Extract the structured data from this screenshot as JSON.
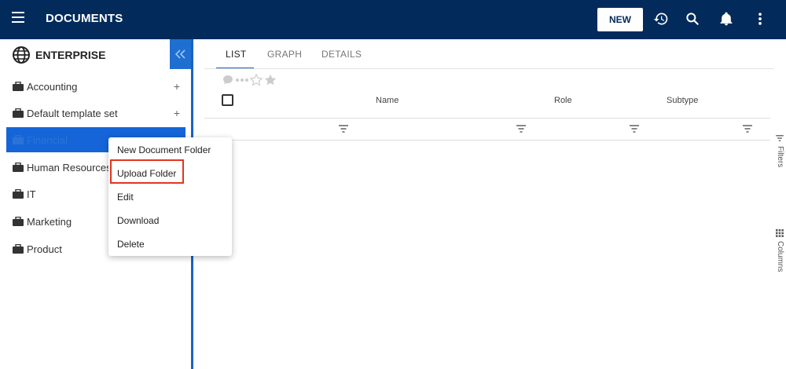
{
  "header": {
    "title": "DOCUMENTS",
    "new_label": "NEW",
    "icons": [
      "menu-icon",
      "history-icon",
      "search-icon",
      "bell-icon",
      "more-vert-icon"
    ]
  },
  "sidebar": {
    "title": "ENTERPRISE",
    "items": [
      {
        "label": "Accounting",
        "expandable": true
      },
      {
        "label": "Default template set",
        "expandable": true
      },
      {
        "label": "Financial",
        "selected": true
      },
      {
        "label": "Human Resources"
      },
      {
        "label": "IT"
      },
      {
        "label": "Marketing"
      },
      {
        "label": "Product"
      }
    ]
  },
  "main": {
    "tabs": [
      {
        "label": "LIST",
        "active": true
      },
      {
        "label": "GRAPH"
      },
      {
        "label": "DETAILS"
      }
    ],
    "columns": [
      "Name",
      "Role",
      "Subtype"
    ],
    "side_panels": [
      "Filters",
      "Columns"
    ]
  },
  "context_menu": {
    "items": [
      "New Document Folder",
      "Upload Folder",
      "Edit",
      "Download",
      "Delete"
    ],
    "highlighted": "Upload Folder"
  },
  "colors": {
    "header_bg": "#022b5c",
    "accent": "#1565c0",
    "highlight_border": "#e3351f"
  }
}
